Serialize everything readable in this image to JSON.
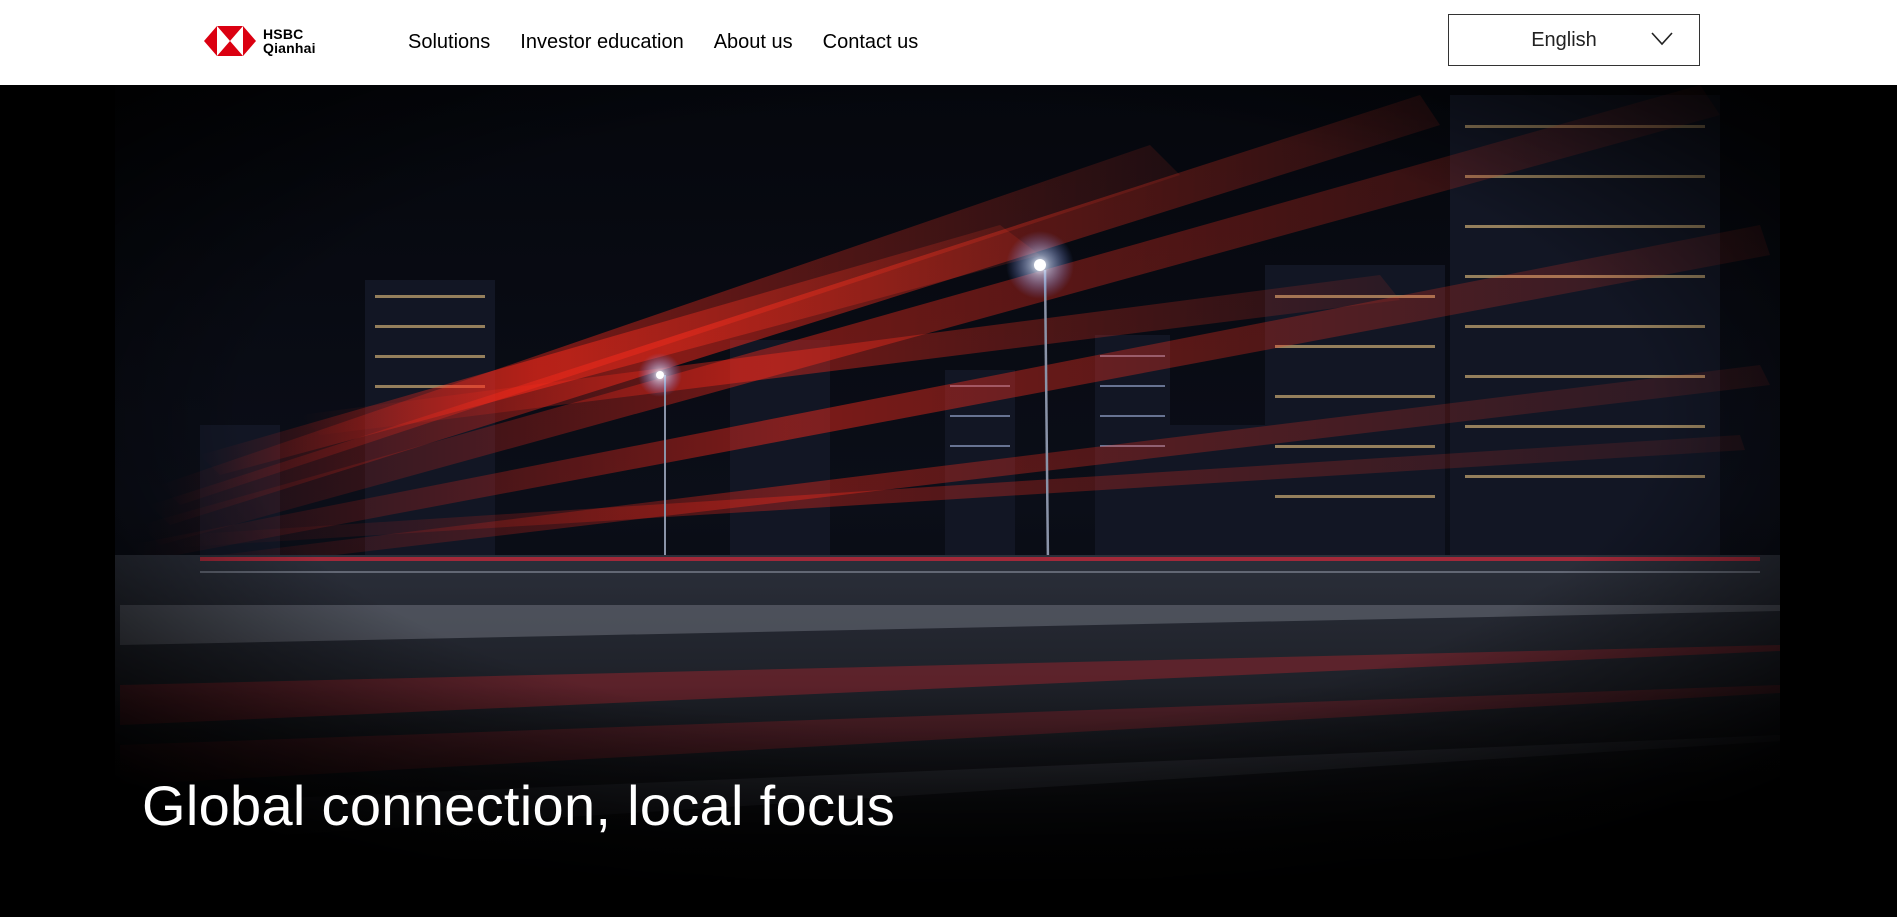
{
  "brand": {
    "name_line1": "HSBC",
    "name_line2": "Qianhai",
    "logo_color": "#db0011"
  },
  "nav": {
    "items": [
      {
        "label": "Solutions"
      },
      {
        "label": "Investor education"
      },
      {
        "label": "About us"
      },
      {
        "label": "Contact us"
      }
    ]
  },
  "language_select": {
    "selected": "English",
    "icon": "chevron-down-icon"
  },
  "hero": {
    "title": "Global connection, local focus",
    "image_description_icon": "city-night-light-trails-image",
    "accent_color": "#e0101c"
  }
}
